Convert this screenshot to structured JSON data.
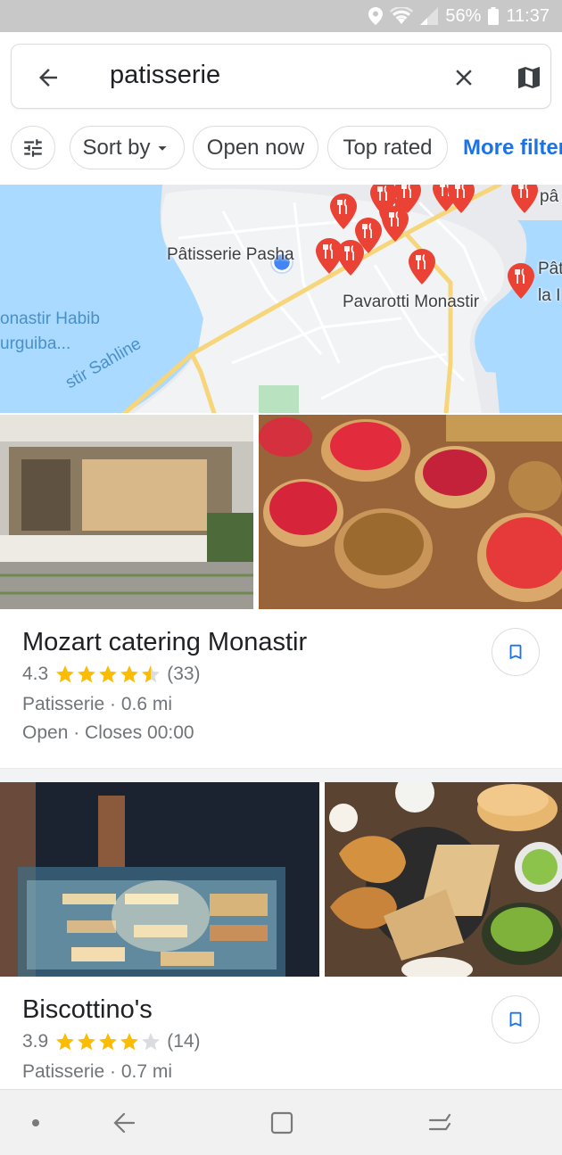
{
  "status_bar": {
    "battery_percent": "56%",
    "time": "11:37",
    "icons": [
      "location-icon",
      "wifi-icon",
      "signal-icon",
      "battery-icon"
    ]
  },
  "search": {
    "query": "patisserie",
    "icons": [
      "back-arrow-icon",
      "clear-icon",
      "map-icon"
    ]
  },
  "filters": {
    "chips": [
      "Sort by",
      "Open now",
      "Top rated"
    ],
    "more_label": "More filter",
    "accent": "#1a73e8"
  },
  "map": {
    "labels": {
      "pasha": "Pâtisserie Pasha",
      "pavarotti": "Pavarotti Monastir",
      "airport": "onastir Habib",
      "airport2": "urguiba...",
      "sahline": "stir Sahline",
      "right1": "pâ",
      "right2": "Pât",
      "right3": "la I"
    }
  },
  "results": [
    {
      "name": "Mozart catering Monastir",
      "rating": "4.3",
      "rating_value": 4.3,
      "reviews": "(33)",
      "category_distance": "Patisserie · 0.6 mi",
      "hours": "Open · Closes 00:00"
    },
    {
      "name": "Biscottino's",
      "rating": "3.9",
      "rating_value": 3.9,
      "reviews": "(14)",
      "category_distance": "Patisserie · 0.7 mi"
    }
  ],
  "colors": {
    "star": "#fbbc04",
    "star_empty": "#dadce0",
    "pin": "#ea4335",
    "location_dot": "#4285f4"
  }
}
